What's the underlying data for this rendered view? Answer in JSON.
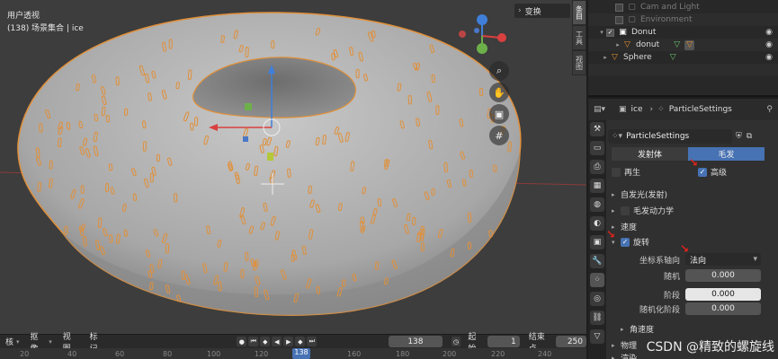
{
  "viewport": {
    "mode_label": "用户透视",
    "collection_label": "(138) 场景集合 | ice",
    "transform_panel": "变换",
    "sidebar_tabs": [
      "条目",
      "工具",
      "视图"
    ],
    "gizmo_buttons": [
      "zoom-icon",
      "pan-hand-icon",
      "camera-icon",
      "grid-icon"
    ],
    "axis_labels": {
      "z": "Z",
      "y": "Y",
      "x": "X"
    }
  },
  "bottombar": {
    "menu_1": "核",
    "menu_2": "抠像",
    "menu_3": "视图",
    "menu_4": "标记",
    "current_frame": "138",
    "start_label": "起始",
    "start_value": "1",
    "end_label": "结束点",
    "end_value": "250"
  },
  "timeline": {
    "ticks": [
      "20",
      "40",
      "60",
      "80",
      "100",
      "120",
      "160",
      "180",
      "200",
      "220",
      "240"
    ],
    "current": "138"
  },
  "outliner": {
    "rows": [
      {
        "label": "Cam and Light",
        "dim": true
      },
      {
        "label": "Environment",
        "dim": true
      },
      {
        "label": "Donut",
        "dim": false
      },
      {
        "label": "donut",
        "dim": false
      },
      {
        "label": "Sphere",
        "dim": false
      }
    ]
  },
  "properties": {
    "breadcrumb_object": "ice",
    "breadcrumb_settings": "ParticleSettings",
    "datablock_name": "ParticleSettings",
    "type_tabs": {
      "emitter": "发射体",
      "hair": "毛发"
    },
    "regrow_label": "再生",
    "advanced_label": "高级",
    "sections": {
      "emission": "自发光(发射)",
      "hair_dynamics": "毛发动力学",
      "velocity": "速度",
      "rotation": "旋转",
      "angular_velocity": "角速度",
      "physics": "物理",
      "render": "渲染"
    },
    "fields": {
      "orientation_axis_label": "坐标系轴向",
      "orientation_axis_value": "法向",
      "random_label": "随机",
      "random_value": "0.000",
      "phase_label": "阶段",
      "phase_value": "0.000",
      "random_phase_label": "随机化阶段",
      "random_phase_value": "0.000"
    }
  },
  "watermark": "CSDN @精致的螺旋线"
}
